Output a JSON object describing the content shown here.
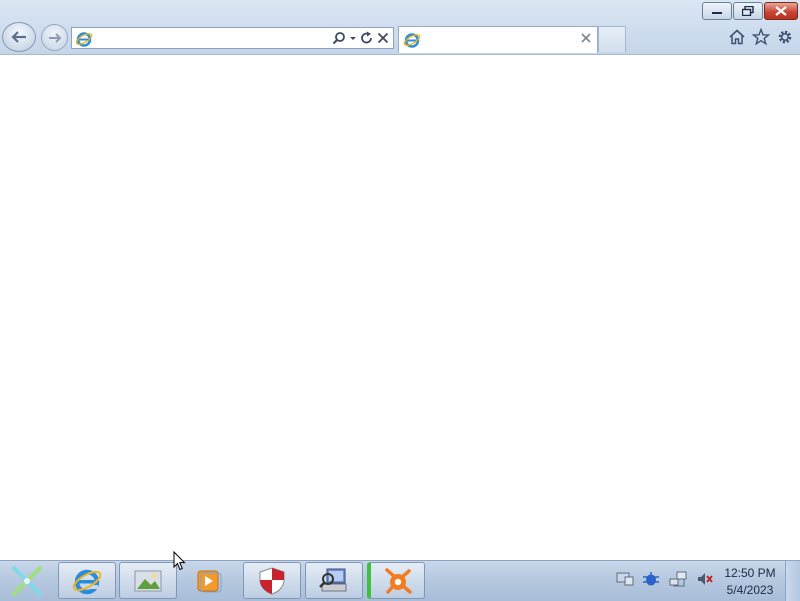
{
  "window": {
    "controls": {
      "minimize_icon": "minimize-icon",
      "restore_icon": "restore-icon",
      "close_icon": "close-icon"
    }
  },
  "toolbar": {
    "address_value": "",
    "tab_title": "",
    "icons": [
      "back-arrow-icon",
      "forward-arrow-icon",
      "ie-logo-icon",
      "search-icon",
      "dropdown-arrow-icon",
      "refresh-icon",
      "stop-icon",
      "home-icon",
      "favorites-star-icon",
      "tools-gear-icon"
    ]
  },
  "taskbar": {
    "apps": [
      "start-button",
      "internet-explorer",
      "image-viewer",
      "media-player",
      "security-shield",
      "network-scanner",
      "avast-antivirus"
    ],
    "clock": {
      "time": "12:50 PM",
      "date": "5/4/2023"
    },
    "tray_icons": [
      "display-icon",
      "network-bug-icon",
      "network-icon",
      "volume-muted-icon"
    ]
  },
  "colors": {
    "chrome_bg": "#cddcee",
    "close_red": "#c74634",
    "taskbar_bg": "#b7c9e0"
  }
}
